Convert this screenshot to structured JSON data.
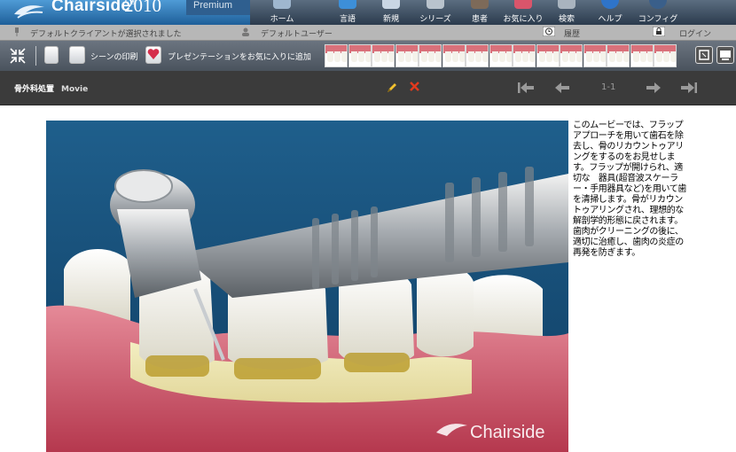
{
  "app": {
    "name": "Chairside",
    "trademark": "®",
    "year": "2010",
    "edition": "Premium"
  },
  "nav": [
    {
      "label": "ホーム",
      "icon": "home-icon"
    },
    {
      "label": "言語",
      "icon": "language-icon"
    },
    {
      "label": "新規",
      "icon": "new-icon"
    },
    {
      "label": "シリーズ",
      "icon": "series-icon"
    },
    {
      "label": "患者",
      "icon": "patient-icon"
    },
    {
      "label": "お気に入り",
      "icon": "favorites-icon"
    },
    {
      "label": "検索",
      "icon": "search-icon"
    },
    {
      "label": "ヘルプ",
      "icon": "help-icon"
    },
    {
      "label": "コンフィグ",
      "icon": "config-icon"
    }
  ],
  "infobar": {
    "client": "デフォルトクライアントが選択されました",
    "user": "デフォルトユーザー",
    "history": "履歴",
    "login": "ログイン"
  },
  "toolbar": {
    "print_scene": "シーンの印刷",
    "add_favorite": "プレゼンテーションをお気に入りに追加"
  },
  "presentation": {
    "title": "骨外科処置",
    "type": "Movie",
    "page": "1-1"
  },
  "video": {
    "watermark": "Chairside"
  },
  "description": "このムービーでは、フラップアプローチを用いて歯石を除去し、骨のリカウントゥアリングをするのをお見せします。フラップが開けられ、適切な　器具(超音波スケーラー・手用器具など)を用いて歯を清掃します。骨がリカウントゥアリングされ、理想的な解剖学的形態に戻されます。歯肉がクリーニングの後に、適切に治癒し、歯肉の炎症の再発を防ぎます。",
  "colors": {
    "brand_blue": "#2f78b8",
    "toolbar": "#5a626b",
    "subbar": "#3b3b3b",
    "edit_icon": "#f2c12e",
    "delete_icon": "#e23a1e"
  }
}
